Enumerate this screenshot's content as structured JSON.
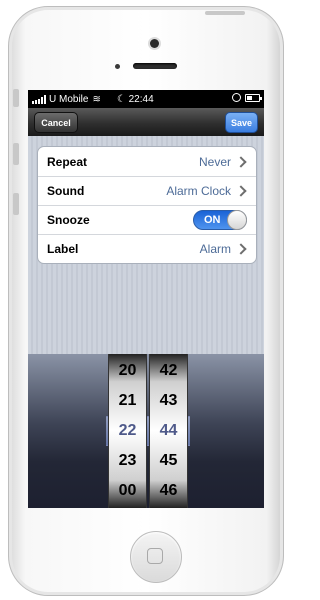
{
  "status_bar": {
    "carrier": "U Mobile",
    "time": "22:44",
    "wifi_icon": "wifi-icon",
    "battery_level": 0.45
  },
  "nav": {
    "cancel_label": "Cancel",
    "save_label": "Save"
  },
  "settings": {
    "rows": [
      {
        "label": "Repeat",
        "value": "Never"
      },
      {
        "label": "Sound",
        "value": "Alarm Clock"
      },
      {
        "label": "Snooze",
        "toggle_label": "ON",
        "toggle_on": true
      },
      {
        "label": "Label",
        "value": "Alarm"
      }
    ]
  },
  "picker": {
    "hours": [
      "20",
      "21",
      "22",
      "23",
      "00"
    ],
    "minutes": [
      "42",
      "43",
      "44",
      "45",
      "46"
    ],
    "selected_hour": "22",
    "selected_minute": "44"
  },
  "colors": {
    "toggle_on": "#2d7ae6",
    "save_button": "#3b7ee0",
    "row_value": "#4d6b97"
  }
}
